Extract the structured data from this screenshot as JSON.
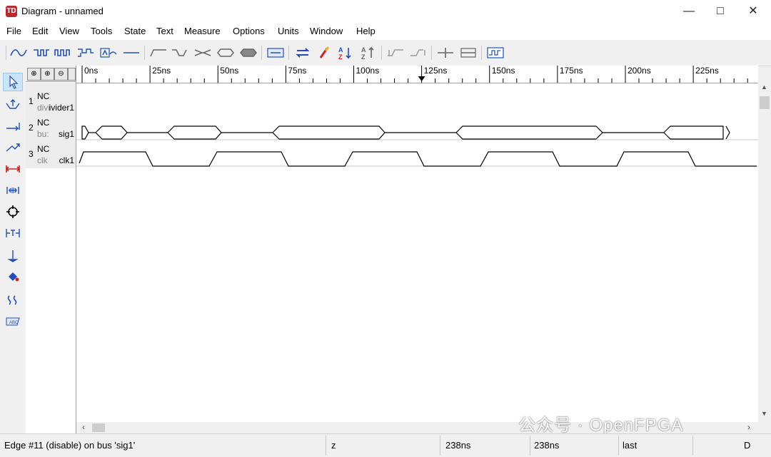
{
  "window": {
    "title": "Diagram - unnamed",
    "app_icon_text": "TD"
  },
  "menu": [
    "File",
    "Edit",
    "View",
    "Tools",
    "State",
    "Text",
    "Measure",
    "Options",
    "Units",
    "Window",
    "Help"
  ],
  "ruler": {
    "labels": [
      "0ns",
      "25ns",
      "50ns",
      "75ns",
      "100ns",
      "125ns",
      "150ns",
      "175ns",
      "200ns",
      "225ns",
      "25"
    ],
    "marker_ns": 125
  },
  "signals": [
    {
      "index": "1",
      "nc": "NC",
      "type": "divi",
      "name": "ivider1"
    },
    {
      "index": "2",
      "nc": "NC",
      "type": "bu:",
      "name": "sig1"
    },
    {
      "index": "3",
      "nc": "NC",
      "type": "clk",
      "name": "clk1"
    }
  ],
  "zoom_buttons": [
    "zoom-in-icon",
    "zoom-in-more-icon",
    "zoom-out-icon",
    "zoom-partial-icon"
  ],
  "status": {
    "message": "Edge #11 (disable) on bus 'sig1'",
    "state": "z",
    "time1": "238ns",
    "time2": "238ns",
    "mode": "last",
    "flag": "D"
  },
  "watermark": "公众号 · OpenFPGA",
  "colors": {
    "tool_blue": "#1f4fbf",
    "accent_red": "#d02020",
    "wave": "#000000"
  }
}
